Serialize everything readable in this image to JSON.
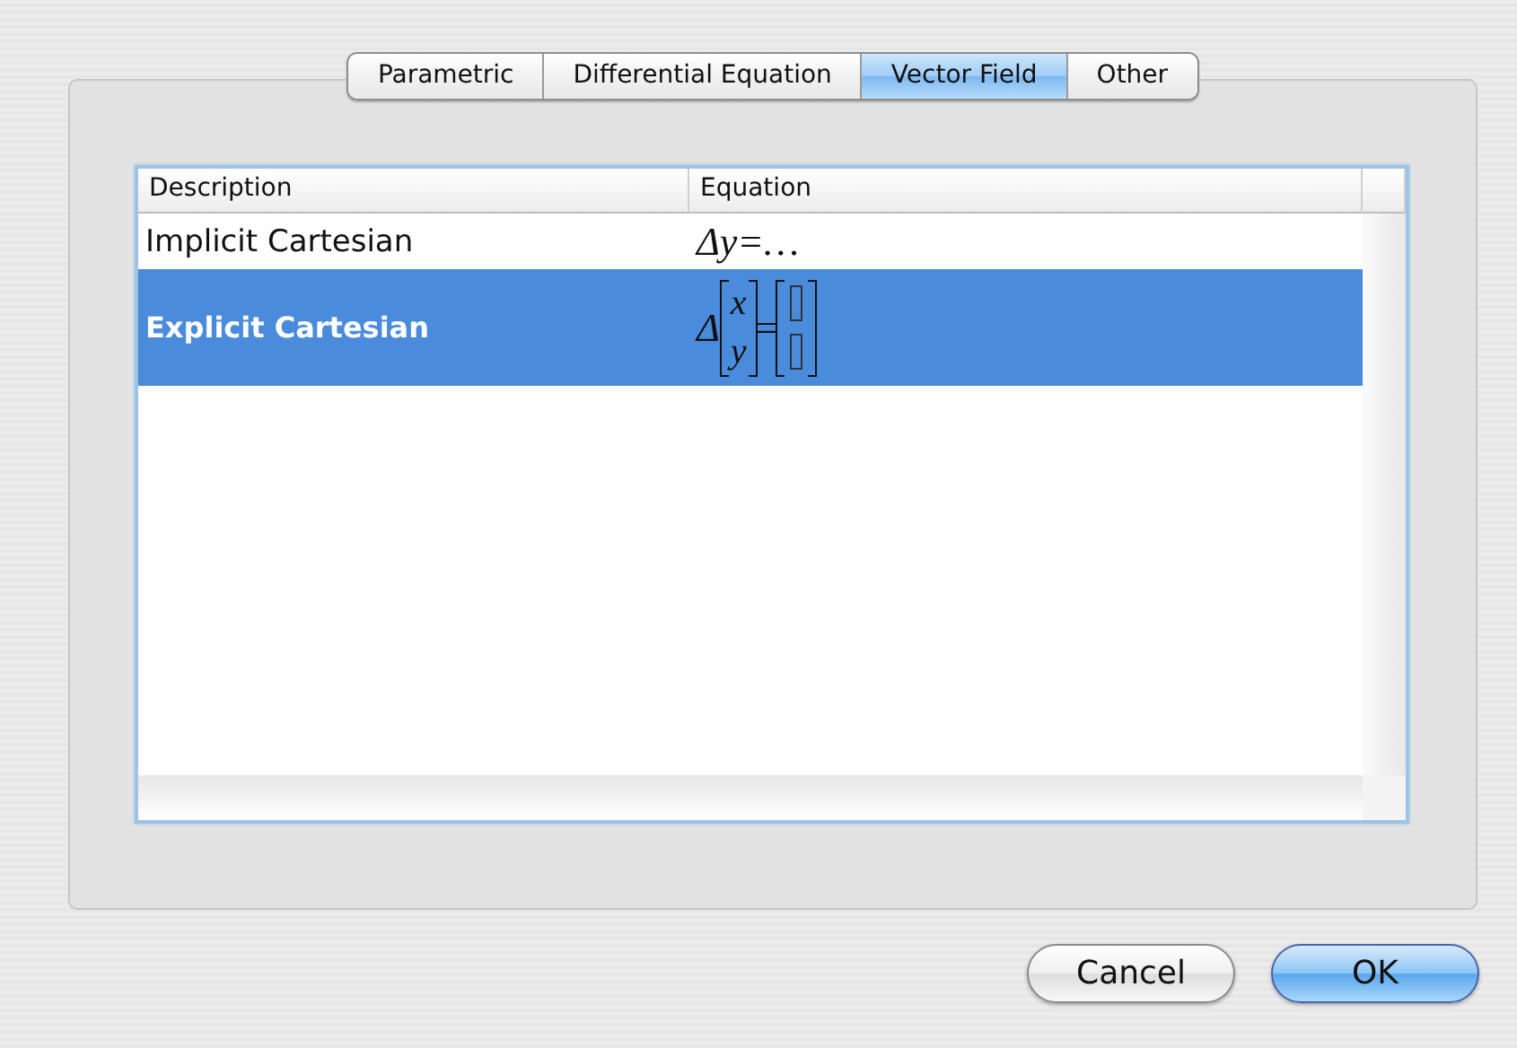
{
  "tabs": [
    {
      "label": "Parametric",
      "selected": false
    },
    {
      "label": "Differential Equation",
      "selected": false
    },
    {
      "label": "Vector Field",
      "selected": true
    },
    {
      "label": "Other",
      "selected": false
    }
  ],
  "table": {
    "columns": [
      "Description",
      "Equation"
    ],
    "rows": [
      {
        "description": "Implicit Cartesian",
        "selected": false,
        "equation": {
          "kind": "inline",
          "text": "Δy=…"
        }
      },
      {
        "description": "Explicit Cartesian",
        "selected": true,
        "equation": {
          "kind": "vector",
          "operator": "Δ",
          "components": [
            "x",
            "y"
          ],
          "equals": "="
        }
      }
    ]
  },
  "buttons": [
    {
      "label": "Cancel",
      "default": false
    },
    {
      "label": "OK",
      "default": true
    }
  ]
}
